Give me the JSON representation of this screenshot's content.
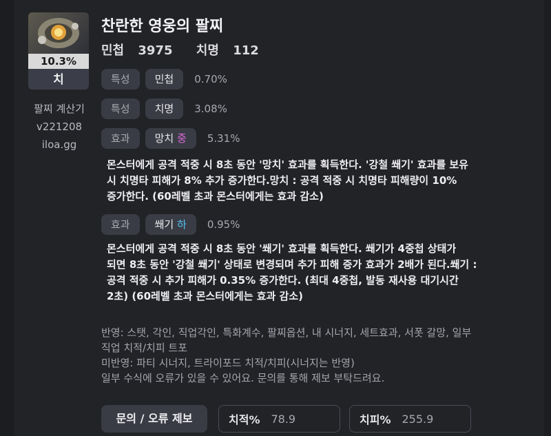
{
  "item": {
    "percent": "10.3%",
    "grade": "치",
    "name": "찬란한 영웅의 팔찌",
    "stats": [
      {
        "label": "민첩",
        "value": "3975"
      },
      {
        "label": "치명",
        "value": "112"
      }
    ]
  },
  "calculator": {
    "title": "팔찌 계산기",
    "version": "v221208",
    "site": "iloa.gg"
  },
  "effects": [
    {
      "type": "특성",
      "name": "민첩",
      "grade": "",
      "value": "0.70%"
    },
    {
      "type": "특성",
      "name": "치명",
      "grade": "",
      "value": "3.08%"
    },
    {
      "type": "효과",
      "name": "망치",
      "grade": "중",
      "value": "5.31%",
      "description_lines": [
        "몬스터에게 공격 적중 시 8초 동안 '망치' 효과를 획득한다. '강철 쐐기' 효과를 보유",
        "시 치명타 피해가 8% 추가 증가한다.망치 : 공격 적중 시 치명타 피해량이 10%",
        "증가한다. (60레벨 초과 몬스터에게는 효과 감소)"
      ]
    },
    {
      "type": "효과",
      "name": "쐐기",
      "grade": "하",
      "value": "0.95%",
      "description_lines": [
        "몬스터에게 공격 적중 시 8초 동안 '쐐기' 효과를 획득한다. 쐐기가 4중첩 상태가",
        "되면 8초 동안 '강철 쐐기' 상태로 변경되며 추가 피해 증가 효과가 2배가 된다.쐐기 :",
        "공격 적중 시 추가 피해가 0.35% 증가한다. (최대 4중첩, 발동 재사용 대기시간",
        "2초) (60레벨 초과 몬스터에게는 효과 감소)"
      ]
    }
  ],
  "notes": [
    "반영: 스탯, 각인, 직업각인, 특화계수, 팔찌옵션, 내 시너지, 세트효과, 서폿 갈망, 일부",
    "직업 치적/치피 트포",
    "미반영: 파티 시너지, 트라이포드 치적/치피(시너지는 반영)",
    "일부 수식에 오류가 있을 수 있어요. 문의를 통해 제보 부탁드려요."
  ],
  "footer": {
    "report_button": "문의 / 오류 제보",
    "crit_rate_label": "치적%",
    "crit_rate_value": "78.9",
    "crit_damage_label": "치피%",
    "crit_damage_value": "255.9"
  },
  "colors": {
    "background": "#222327",
    "chip": "#3a3c45",
    "grade_mid": "#d86ad6",
    "grade_low": "#52c4f2"
  }
}
